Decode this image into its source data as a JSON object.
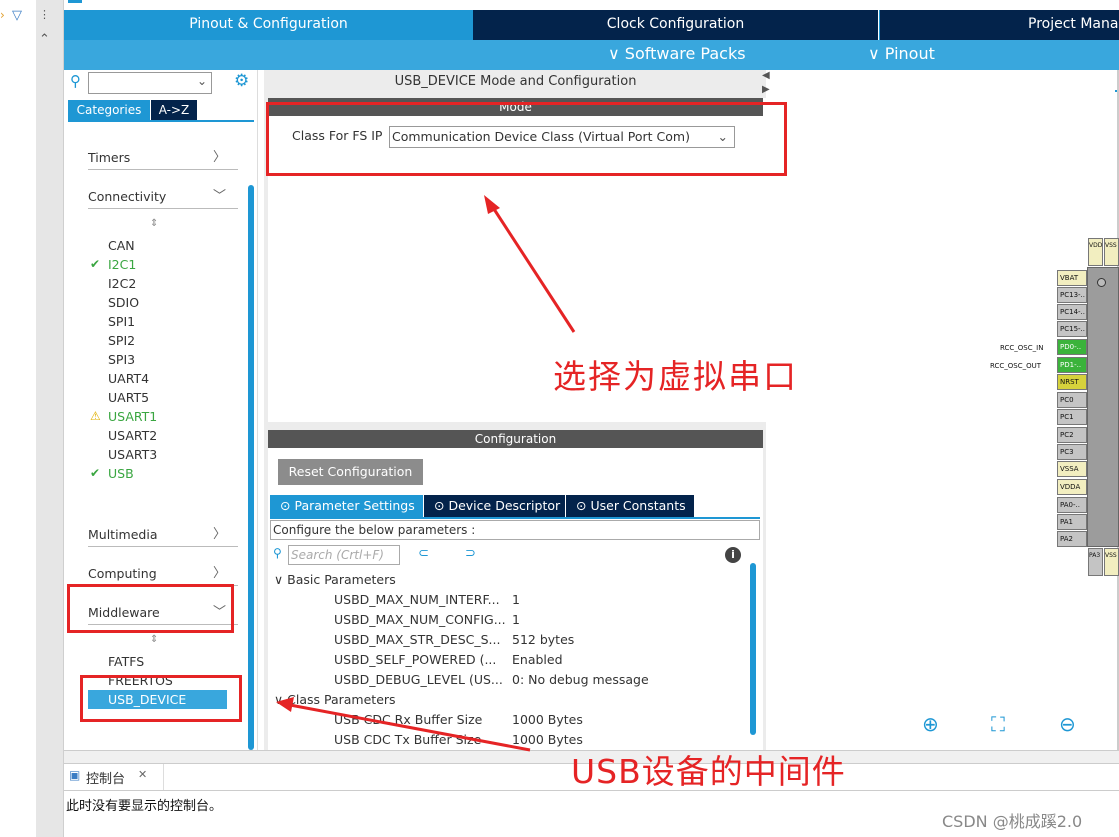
{
  "tabs": {
    "pinout_config": "Pinout & Configuration",
    "clock_config": "Clock Configuration",
    "project_manager": "Project Manag"
  },
  "submenu": {
    "software_packs": "∨ Software Packs",
    "pinout": "∨ Pinout"
  },
  "left": {
    "categories_tab": "Categories",
    "az_tab": "A->Z",
    "sections": {
      "timers": "Timers",
      "connectivity": "Connectivity",
      "multimedia": "Multimedia",
      "computing": "Computing",
      "middleware": "Middleware"
    },
    "connectivity_items": [
      "CAN",
      "I2C1",
      "I2C2",
      "SDIO",
      "SPI1",
      "SPI2",
      "SPI3",
      "UART4",
      "UART5",
      "USART1",
      "USART2",
      "USART3",
      "USB"
    ],
    "middleware_items": [
      "FATFS",
      "FREERTOS",
      "USB_DEVICE"
    ]
  },
  "center": {
    "title": "USB_DEVICE Mode and Configuration",
    "mode_header": "Mode",
    "class_label": "Class For FS IP",
    "class_value": "Communication Device Class (Virtual Port Com)",
    "config_header": "Configuration",
    "reset_button": "Reset Configuration",
    "param_tabs": [
      "Parameter Settings",
      "Device Descriptor",
      "User Constants"
    ],
    "configure_text": "Configure the below parameters :",
    "search_placeholder": "Search (Crtl+F)",
    "basic_group": "Basic Parameters",
    "basic_params": [
      {
        "name": "USBD_MAX_NUM_INTERF...",
        "value": "1"
      },
      {
        "name": "USBD_MAX_NUM_CONFIG...",
        "value": "1"
      },
      {
        "name": "USBD_MAX_STR_DESC_S...",
        "value": "512 bytes"
      },
      {
        "name": "USBD_SELF_POWERED (...",
        "value": "Enabled"
      },
      {
        "name": "USBD_DEBUG_LEVEL (US...",
        "value": "0: No debug message"
      }
    ],
    "class_group": "Class Parameters",
    "class_params": [
      {
        "name": "USB CDC Rx Buffer Size",
        "value": "1000 Bytes"
      },
      {
        "name": "USB CDC Tx Buffer Size",
        "value": "1000 Bytes"
      }
    ]
  },
  "chip": {
    "top_pins": [
      "VDD",
      "VSS"
    ],
    "left_pins": [
      "VBAT",
      "PC13-..",
      "PC14-..",
      "PC15-..",
      "PD0-..",
      "PD1-..",
      "NRST",
      "PC0",
      "PC1",
      "PC2",
      "PC3",
      "VSSA",
      "VDDA",
      "PA0-..",
      "PA1",
      "PA2"
    ],
    "bottom_pins": [
      "PA3",
      "VSS"
    ],
    "signal_osc_in": "RCC_OSC_IN",
    "signal_osc_out": "RCC_OSC_OUT"
  },
  "console": {
    "title": "控制台",
    "message": "此时没有要显示的控制台。"
  },
  "annotations": {
    "select_virtual_port": "选择为虚拟串口",
    "usb_middleware": "USB设备的中间件"
  },
  "watermark": "CSDN @桃成蹊2.0",
  "colors": {
    "accent_blue": "#1e97d4",
    "dark_navy": "#03234b",
    "annotation_red": "#e52425",
    "pin_green": "#3bb33b",
    "pin_yellow": "#e9e57a"
  }
}
